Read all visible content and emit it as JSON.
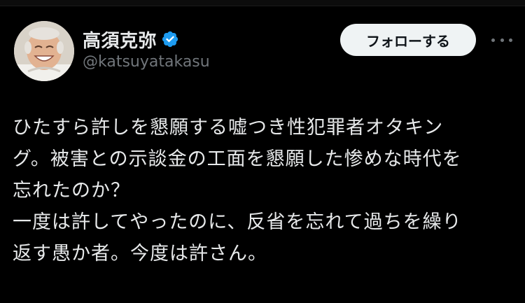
{
  "post": {
    "author": {
      "display_name": "高須克弥",
      "handle": "@katsuyatakasu",
      "verified": true,
      "verified_color": "#1d9bf0"
    },
    "follow_label": "フォローする",
    "more_icon": "more-horizontal-icon",
    "text_lines": [
      "ひたすら許しを懇願する嘘つき性犯罪者オタキン",
      "グ。被害との示談金の工面を懇願した惨めな時代を",
      "忘れたのか？",
      "一度は許してやったのに、反省を忘れて過ちを繰り",
      "返す愚か者。今度は許さん。"
    ]
  },
  "colors": {
    "background": "#000000",
    "primary_text": "#e7e9ea",
    "secondary_text": "#71767b",
    "button_bg": "#eff3f4",
    "button_text": "#0f1419"
  }
}
